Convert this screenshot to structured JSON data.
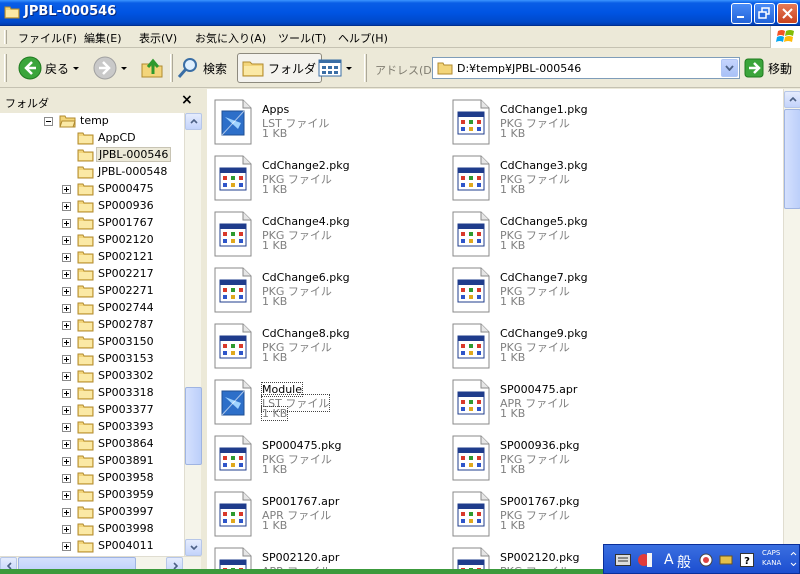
{
  "window": {
    "title": "JPBL-000546"
  },
  "menu": [
    "ファイル(F)",
    "編集(E)",
    "表示(V)",
    "お気に入り(A)",
    "ツール(T)",
    "ヘルプ(H)"
  ],
  "toolbar": {
    "back_label": "戻る",
    "search_label": "検索",
    "folder_label": "フォルダ",
    "address_label": "アドレス(D)",
    "address_value": "D:¥temp¥JPBL-000546",
    "go_label": "移動"
  },
  "folder_pane": {
    "title": "フォルダ",
    "close": "×",
    "tree": [
      {
        "label": "temp",
        "expander": "minus",
        "indent": 0
      },
      {
        "label": "AppCD",
        "expander": "none",
        "indent": 1
      },
      {
        "label": "JPBL-000546",
        "expander": "none",
        "indent": 1,
        "selected": true
      },
      {
        "label": "JPBL-000548",
        "expander": "none",
        "indent": 1
      },
      {
        "label": "SP000475",
        "expander": "plus",
        "indent": 1
      },
      {
        "label": "SP000936",
        "expander": "plus",
        "indent": 1
      },
      {
        "label": "SP001767",
        "expander": "plus",
        "indent": 1
      },
      {
        "label": "SP002120",
        "expander": "plus",
        "indent": 1
      },
      {
        "label": "SP002121",
        "expander": "plus",
        "indent": 1
      },
      {
        "label": "SP002217",
        "expander": "plus",
        "indent": 1
      },
      {
        "label": "SP002271",
        "expander": "plus",
        "indent": 1
      },
      {
        "label": "SP002744",
        "expander": "plus",
        "indent": 1
      },
      {
        "label": "SP002787",
        "expander": "plus",
        "indent": 1
      },
      {
        "label": "SP003150",
        "expander": "plus",
        "indent": 1
      },
      {
        "label": "SP003153",
        "expander": "plus",
        "indent": 1
      },
      {
        "label": "SP003302",
        "expander": "plus",
        "indent": 1
      },
      {
        "label": "SP003318",
        "expander": "plus",
        "indent": 1
      },
      {
        "label": "SP003377",
        "expander": "plus",
        "indent": 1
      },
      {
        "label": "SP003393",
        "expander": "plus",
        "indent": 1
      },
      {
        "label": "SP003864",
        "expander": "plus",
        "indent": 1
      },
      {
        "label": "SP003891",
        "expander": "plus",
        "indent": 1
      },
      {
        "label": "SP003958",
        "expander": "plus",
        "indent": 1
      },
      {
        "label": "SP003959",
        "expander": "plus",
        "indent": 1
      },
      {
        "label": "SP003997",
        "expander": "plus",
        "indent": 1
      },
      {
        "label": "SP003998",
        "expander": "plus",
        "indent": 1
      },
      {
        "label": "SP004011",
        "expander": "plus",
        "indent": 1
      }
    ]
  },
  "files": [
    {
      "name": "Apps",
      "type": "LST ファイル",
      "size": "1 KB",
      "icon": "lst-file-icon"
    },
    {
      "name": "CdChange1.pkg",
      "type": "PKG ファイル",
      "size": "1 KB",
      "icon": "pkg-file-icon"
    },
    {
      "name": "CdChange2.pkg",
      "type": "PKG ファイル",
      "size": "1 KB",
      "icon": "pkg-file-icon"
    },
    {
      "name": "CdChange3.pkg",
      "type": "PKG ファイル",
      "size": "1 KB",
      "icon": "pkg-file-icon"
    },
    {
      "name": "CdChange4.pkg",
      "type": "PKG ファイル",
      "size": "1 KB",
      "icon": "pkg-file-icon"
    },
    {
      "name": "CdChange5.pkg",
      "type": "PKG ファイル",
      "size": "1 KB",
      "icon": "pkg-file-icon"
    },
    {
      "name": "CdChange6.pkg",
      "type": "PKG ファイル",
      "size": "1 KB",
      "icon": "pkg-file-icon"
    },
    {
      "name": "CdChange7.pkg",
      "type": "PKG ファイル",
      "size": "1 KB",
      "icon": "pkg-file-icon"
    },
    {
      "name": "CdChange8.pkg",
      "type": "PKG ファイル",
      "size": "1 KB",
      "icon": "pkg-file-icon"
    },
    {
      "name": "CdChange9.pkg",
      "type": "PKG ファイル",
      "size": "1 KB",
      "icon": "pkg-file-icon"
    },
    {
      "name": "Module",
      "type": "LST ファイル",
      "size": "1 KB",
      "icon": "lst-file-icon",
      "focused": true
    },
    {
      "name": "SP000475.apr",
      "type": "APR ファイル",
      "size": "1 KB",
      "icon": "pkg-file-icon"
    },
    {
      "name": "SP000475.pkg",
      "type": "PKG ファイル",
      "size": "1 KB",
      "icon": "pkg-file-icon"
    },
    {
      "name": "SP000936.pkg",
      "type": "PKG ファイル",
      "size": "1 KB",
      "icon": "pkg-file-icon"
    },
    {
      "name": "SP001767.apr",
      "type": "APR ファイル",
      "size": "1 KB",
      "icon": "pkg-file-icon"
    },
    {
      "name": "SP001767.pkg",
      "type": "PKG ファイル",
      "size": "1 KB",
      "icon": "pkg-file-icon"
    },
    {
      "name": "SP002120.apr",
      "type": "APR ファイル",
      "size": "",
      "icon": "pkg-file-icon"
    },
    {
      "name": "SP002120.pkg",
      "type": "PKG ファイル",
      "size": "",
      "icon": "pkg-file-icon"
    }
  ],
  "ime": {
    "mode": "A",
    "kanji": "般",
    "caps": "CAPS",
    "kana": "KANA"
  },
  "colors": {
    "titlebar": "#0054e3",
    "selection": "#ece9d8",
    "chrome": "#ece9d8"
  }
}
